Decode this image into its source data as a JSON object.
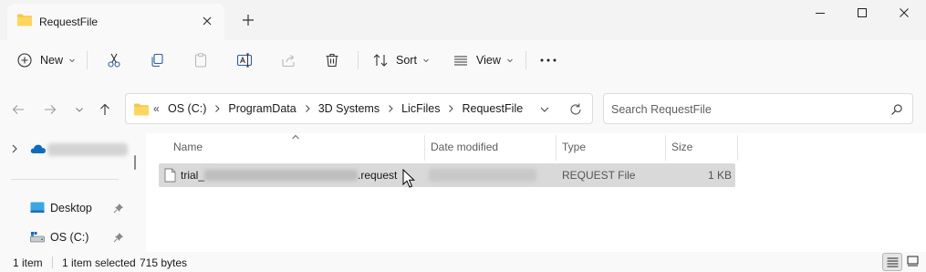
{
  "window": {
    "tab_title": "RequestFile",
    "tab_icon": "folder-icon",
    "colors": {
      "folder": "#f5c84c",
      "cloud": "#0f6cbd",
      "selection": "#d9d9d9",
      "desktop": "#3aa7e4"
    }
  },
  "commands": {
    "new": "New",
    "sort": "Sort",
    "view": "View",
    "icons": [
      "plus-circle-icon",
      "cut-icon",
      "copy-icon",
      "paste-icon",
      "rename-icon",
      "share-icon",
      "delete-icon",
      "sort-icon",
      "view-icon",
      "more-icon"
    ]
  },
  "address": {
    "overflow": "«",
    "crumbs": [
      "OS (C:)",
      "ProgramData",
      "3D Systems",
      "LicFiles",
      "RequestFile"
    ]
  },
  "search": {
    "placeholder": "Search RequestFile"
  },
  "nav_pane": {
    "items": [
      {
        "label": "Desktop",
        "icon": "desktop-icon",
        "pinned": true
      },
      {
        "label": "OS (C:)",
        "icon": "drive-icon",
        "pinned": true
      }
    ]
  },
  "columns": {
    "name": "Name",
    "date": "Date modified",
    "type": "Type",
    "size": "Size"
  },
  "files": [
    {
      "name_prefix": "trial_",
      "name_suffix": ".request",
      "type": "REQUEST File",
      "size": "1 KB"
    }
  ],
  "status": {
    "count": "1 item",
    "selected": "1 item selected",
    "size": "715 bytes"
  }
}
